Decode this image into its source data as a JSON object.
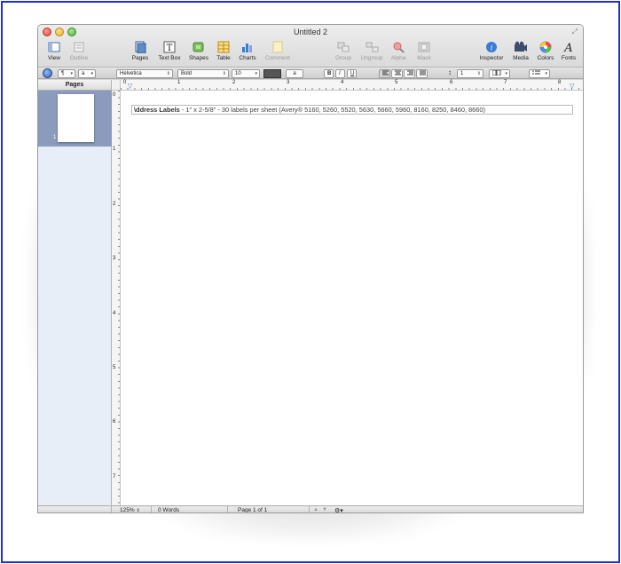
{
  "window": {
    "title": "Untitled 2"
  },
  "toolbar": {
    "items": [
      {
        "label": "View",
        "icon": "view-icon",
        "enabled": true
      },
      {
        "label": "Outline",
        "icon": "outline-icon",
        "enabled": false
      },
      {
        "label": "Pages",
        "icon": "pages-icon",
        "enabled": true
      },
      {
        "label": "Text Box",
        "icon": "text-box-icon",
        "enabled": true
      },
      {
        "label": "Shapes",
        "icon": "shapes-icon",
        "enabled": true
      },
      {
        "label": "Table",
        "icon": "table-icon",
        "enabled": true
      },
      {
        "label": "Charts",
        "icon": "charts-icon",
        "enabled": true
      },
      {
        "label": "Comment",
        "icon": "comment-icon",
        "enabled": false
      },
      {
        "label": "Group",
        "icon": "group-icon",
        "enabled": false
      },
      {
        "label": "Ungroup",
        "icon": "ungroup-icon",
        "enabled": false
      },
      {
        "label": "Alpha",
        "icon": "alpha-icon",
        "enabled": false
      },
      {
        "label": "Mask",
        "icon": "mask-icon",
        "enabled": false
      },
      {
        "label": "Inspector",
        "icon": "inspector-icon",
        "enabled": true
      },
      {
        "label": "Media",
        "icon": "media-icon",
        "enabled": true
      },
      {
        "label": "Colors",
        "icon": "colors-icon",
        "enabled": true
      },
      {
        "label": "Fonts",
        "icon": "fonts-icon",
        "enabled": true
      }
    ]
  },
  "format_bar": {
    "paragraph_style": "¶",
    "character_style": "a",
    "font_family": "Helvetica",
    "font_style": "Bold",
    "font_size": "10",
    "char_sample": "a",
    "bold": "B",
    "italic": "I",
    "underline": "U",
    "line_spacing": "1"
  },
  "sidebar": {
    "header": "Pages",
    "pages": [
      {
        "number": "1"
      }
    ]
  },
  "rulers": {
    "horizontal": [
      "0",
      "1",
      "2",
      "3",
      "4",
      "5",
      "6",
      "7",
      "8"
    ],
    "vertical": [
      "0",
      "1",
      "2",
      "3",
      "4",
      "5",
      "6",
      "7"
    ]
  },
  "document": {
    "line_bold": "\\ddress Labels",
    "line_rest": " - 1\" x 2-5/8\" - 30 labels per sheet (Avery®  5160, 5260, 5520, 5630, 5660, 5960, 8160, 8250, 8460, 8660)"
  },
  "status_bar": {
    "zoom": "125%",
    "words": "0 Words",
    "page": "Page 1 of 1"
  },
  "colors": {
    "frame_border": "#1f2fd8",
    "selection": "#8a9bbd",
    "sidebar_bg": "#e8eef7"
  }
}
